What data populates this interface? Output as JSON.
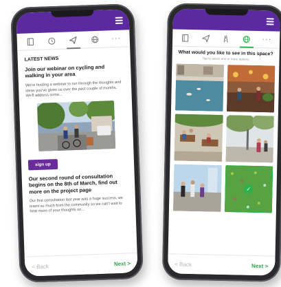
{
  "left_screen": {
    "section_heading": "LATEST NEWS",
    "article1_title": "Join our webinar on cycling and walking in your area",
    "article1_body": "We're hosting a webinar to run through the thoughts and ideas you've given us over the past couple of months. We'll address some...",
    "signup_label": "sign up",
    "article2_title": "Our second round of consultation begins on the 8th of March, find out more on the project page",
    "article2_body": "Our first consultation last year was a huge success, we learnt so much from the community so we can't wait to hear more of your thoughts on...",
    "back_label": "Back",
    "next_label": "Next"
  },
  "right_screen": {
    "question": "What would you like to see in this space?",
    "hint": "Tap to select one or more options",
    "back_label": "Back",
    "next_label": "Next",
    "selected_tile": 5
  },
  "icons": {
    "tabs_left": [
      "book-icon",
      "clock-icon",
      "send-icon",
      "globe-icon",
      "more-icon"
    ],
    "tabs_right": [
      "book-icon",
      "send-icon",
      "road-icon",
      "globe-icon",
      "more-icon"
    ]
  },
  "colors": {
    "brand_purple": "#5b2aa0",
    "button_purple": "#6a2b9b",
    "accent_green": "#2bb34b"
  }
}
